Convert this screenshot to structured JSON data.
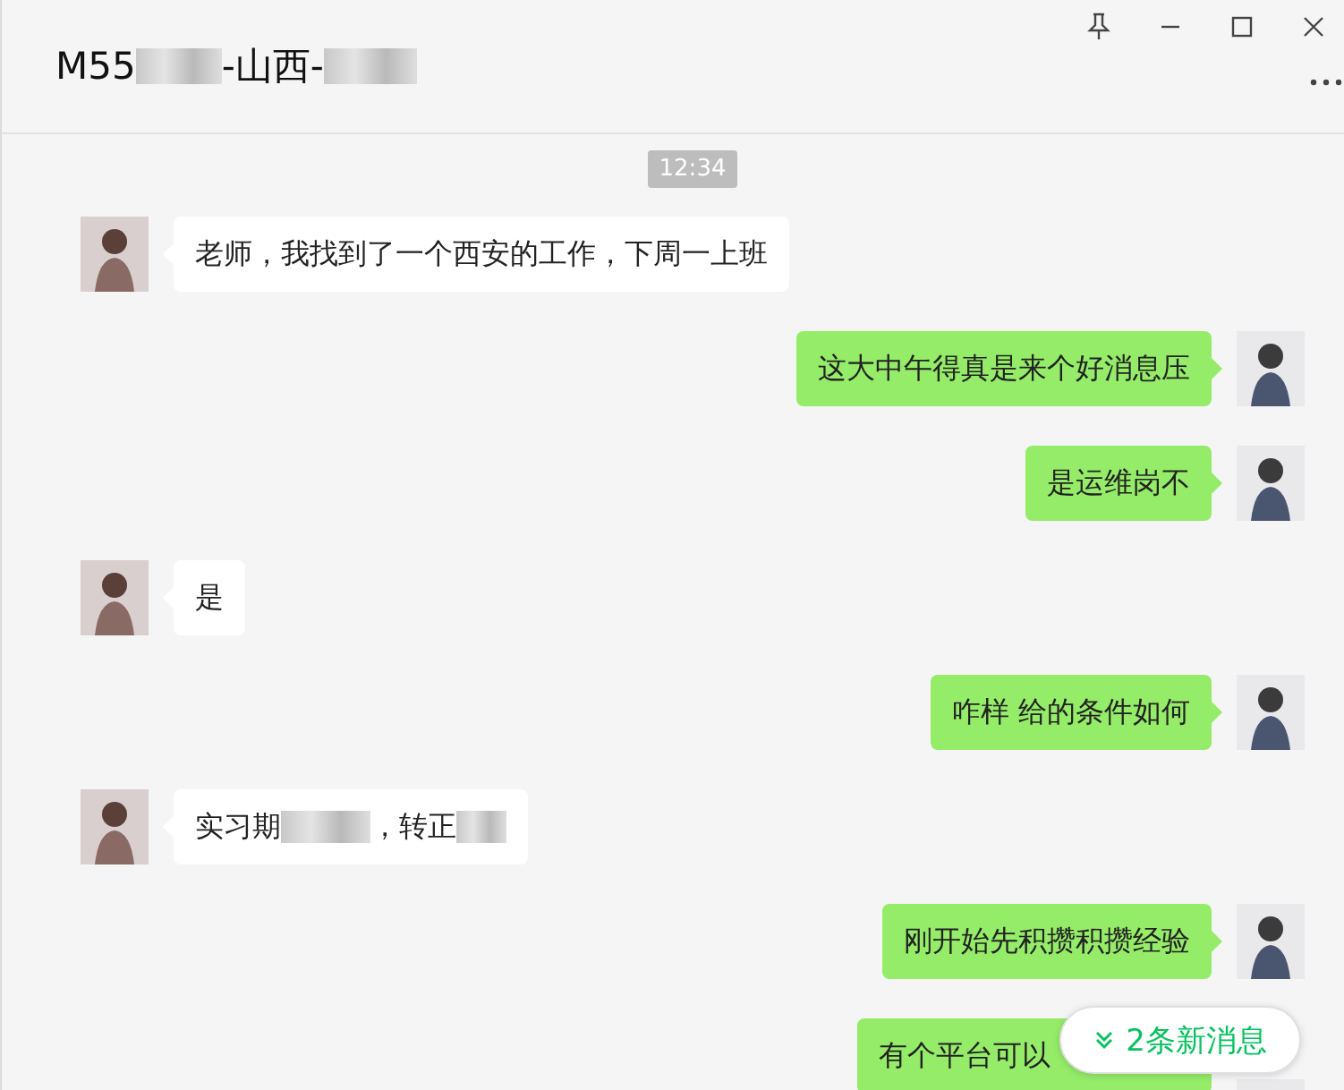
{
  "header": {
    "title_parts": [
      {
        "kind": "text",
        "text": "M55"
      },
      {
        "kind": "blur"
      },
      {
        "kind": "text",
        "text": "-山西-"
      },
      {
        "kind": "blur"
      }
    ]
  },
  "timestamp": "12:34",
  "messages": [
    {
      "outgoing": false,
      "parts": [
        {
          "kind": "text",
          "text": "老师，我找到了一个西安的工作，下周一上班"
        }
      ]
    },
    {
      "outgoing": true,
      "parts": [
        {
          "kind": "text",
          "text": "这大中午得真是来个好消息压"
        }
      ]
    },
    {
      "outgoing": true,
      "parts": [
        {
          "kind": "text",
          "text": "是运维岗不"
        }
      ]
    },
    {
      "outgoing": false,
      "parts": [
        {
          "kind": "text",
          "text": "是"
        }
      ]
    },
    {
      "outgoing": true,
      "parts": [
        {
          "kind": "text",
          "text": "咋样  给的条件如何"
        }
      ]
    },
    {
      "outgoing": false,
      "parts": [
        {
          "kind": "text",
          "text": "实习期"
        },
        {
          "kind": "blur"
        },
        {
          "kind": "text",
          "text": "，转正"
        },
        {
          "kind": "blur"
        }
      ]
    },
    {
      "outgoing": true,
      "parts": [
        {
          "kind": "text",
          "text": "刚开始先积攒积攒经验"
        }
      ]
    },
    {
      "outgoing": true,
      "covered": true,
      "parts": [
        {
          "kind": "text",
          "text": "有个平台可以"
        }
      ]
    }
  ],
  "new_messages_button": "2条新消息"
}
